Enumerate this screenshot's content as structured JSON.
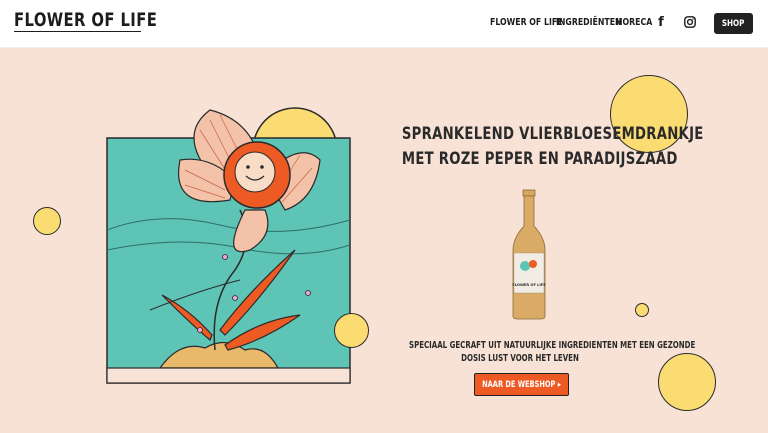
{
  "header": {
    "logo": "FLOWER OF LIFE",
    "nav": [
      "FLOWER OF LIFE",
      "INGREDIËNTEN",
      "HORECA"
    ],
    "social_icons": [
      "facebook-icon",
      "instagram-icon"
    ],
    "shop_label": "SHOP"
  },
  "hero": {
    "headline_line1": "SPRANKELEND VLIERBLOESEMDRANKJE",
    "headline_line2": "MET ROZE PEPER EN PARADIJSZAAD",
    "bottle_label": "FLOWER OF LIFE",
    "sub_line1": "SPECIAAL GECRAFT UIT NATUURLIJKE INGREDIËNTEN MET EEN GEZONDE",
    "sub_line2": "DOSIS LUST VOOR HET LEVEN",
    "cta_label": "NAAR DE WEBSHOP ▸"
  },
  "colors": {
    "background": "#f8e2d6",
    "accent_orange": "#ee5a24",
    "circle_yellow": "#fbdc72",
    "panel_teal": "#5ec4b6",
    "dark": "#222222"
  }
}
